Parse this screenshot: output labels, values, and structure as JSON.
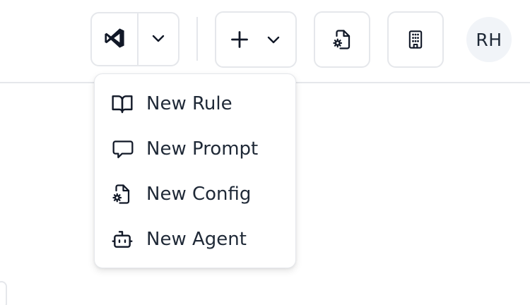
{
  "header": {
    "editor_button": {
      "icon": "vscode-icon"
    },
    "editor_dropdown": {
      "icon": "chevron-down-icon"
    },
    "add_button": {
      "icon": "plus-icon",
      "chevron": "chevron-down-icon"
    },
    "config_button": {
      "icon": "file-gear-icon"
    },
    "organization_button": {
      "icon": "building-icon"
    },
    "avatar": {
      "initials": "RH"
    }
  },
  "add_menu": {
    "items": [
      {
        "label": "New Rule",
        "icon": "book-open-icon"
      },
      {
        "label": "New Prompt",
        "icon": "message-square-icon"
      },
      {
        "label": "New Config",
        "icon": "file-gear-icon"
      },
      {
        "label": "New Agent",
        "icon": "bot-icon"
      }
    ]
  },
  "colors": {
    "border": "#e5e7eb",
    "text": "#1f2937",
    "avatar_bg": "#f1f4f8"
  }
}
